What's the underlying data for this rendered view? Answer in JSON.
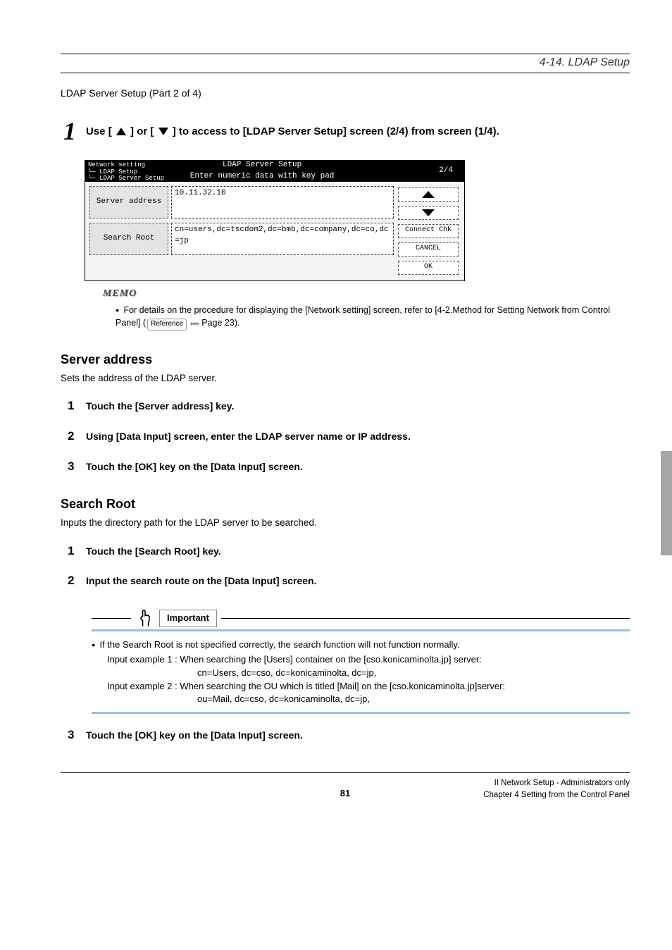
{
  "header": {
    "section": "4-14. LDAP Setup"
  },
  "subtitle": "LDAP Server Setup (Part 2 of 4)",
  "big_step": {
    "num": "1",
    "prefix": "Use ",
    "mid": " or ",
    "suffix": " to access to [LDAP Server Setup] screen (2/4) from screen (1/4)."
  },
  "lcd": {
    "breadcrumb": [
      "Network setting",
      "└─ LDAP Setup",
      "    └─ LDAP Server Setup"
    ],
    "title": "LDAP Server Setup",
    "sub": "Enter numeric data with key pad",
    "page": "2/4",
    "rows": [
      {
        "label": "Server address",
        "value": "10.11.32.10"
      },
      {
        "label": "Search Root",
        "value": "cn=users,dc=tscdom2,dc=bmb,dc=company,dc=co,dc=jp"
      }
    ],
    "right_buttons": [
      "▲",
      "▼",
      "Connect Chk",
      "CANCEL",
      "OK"
    ]
  },
  "memo": {
    "label": "MEMO",
    "text1": "For details on the procedure for displaying the [Network setting] screen, refer to [4-2.Method for Setting Network from Control Panel] (",
    "ref": "Reference",
    "text2": " Page 23)."
  },
  "sections": {
    "server_address": {
      "title": "Server address",
      "desc": "Sets the address of the LDAP server.",
      "steps": [
        "Touch the [Server address] key.",
        "Using [Data Input] screen, enter the LDAP server name or IP address.",
        "Touch the [OK] key on the [Data Input] screen."
      ]
    },
    "search_root": {
      "title": "Search Root",
      "desc": "Inputs the directory path for the LDAP server to be searched.",
      "steps_a": [
        "Touch the [Search Root] key.",
        "Input the search route on the [Data Input] screen."
      ],
      "step_after": "Touch the [OK] key on the [Data Input] screen."
    }
  },
  "important": {
    "label": "Important",
    "bullet": "If the Search Root is not specified correctly, the search function will not function normally.",
    "ex1_line1": "Input example 1 : When searching the [Users] container on the [cso.konicaminolta.jp] server:",
    "ex1_line2": "cn=Users, dc=cso, dc=konicaminolta, dc=jp,",
    "ex2_line1": "Input example 2 : When searching the OU which is titled [Mail] on the [cso.konicaminolta.jp]server:",
    "ex2_line2": "ou=Mail, dc=cso, dc=konicaminolta, dc=jp,"
  },
  "footer": {
    "page": "81",
    "right1": "II Network Setup - Administrators only",
    "right2": "Chapter 4 Setting from the Control Panel"
  }
}
